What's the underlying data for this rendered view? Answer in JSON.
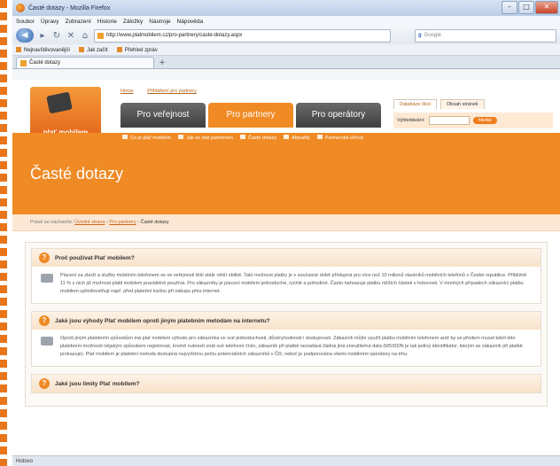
{
  "window": {
    "title": "Časté dotazy - Mozilla Firefox"
  },
  "menu": [
    "Soubor",
    "Úpravy",
    "Zobrazení",
    "Historie",
    "Záložky",
    "Nástroje",
    "Nápověda"
  ],
  "nav": {
    "url": "http://www.platmobilem.cz/pro-partnery/caste-dotazy.aspx",
    "search_placeholder": "Google"
  },
  "bookmarks": [
    "Nejnavštěvovanější",
    "Jak začít",
    "Přehled zpráv"
  ],
  "tab": {
    "label": "Časté dotazy"
  },
  "site": {
    "logo_text": "plať mobilem",
    "top_links": [
      "Home",
      "Přihlášení pro partnery"
    ],
    "main_tabs": [
      "Pro veřejnost",
      "Pro partnery",
      "Pro operátory"
    ],
    "right_tabs": [
      "Databáze škol",
      "Obsah stránek"
    ],
    "search_label": "Vyhledávání:",
    "search_button": "hledat",
    "sub_nav": [
      "Co je plať mobilem",
      "Jak se stát partnerem",
      "Časté dotazy",
      "Aktuality",
      "Partnerská síťová"
    ],
    "page_title": "Časté dotazy",
    "breadcrumb": {
      "prefix": "Právě se nacházíte:",
      "home": "Úvodní strana",
      "sep1": "›",
      "section": "Pro partnery",
      "sep2": "›",
      "current": "Časté dotazy"
    }
  },
  "faqs": [
    {
      "q": "Proč používat Plať mobilem?",
      "a": "Placení za zboží a služby mobilním telefonem se ve veřejnosti těší stále větší oblibě. Tato možnost platby je v současné době přístupná pro více než 10 milionů vlastníků mobilních telefonů v České republice. Přibližně 11 % z nich již možnost platit mobilem pravidelně používá. Pro zákazníky je placení mobilem jednoduché, rychlé a pohodlné. Často nahrazuje platbu nižších částek v hotovosti. V mnohých případech zákazníci platbu mobilem upřednostňují např. před platební kartou při nákupu přes internet."
    },
    {
      "q": "Jaké jsou výhody Plať mobilem oproti jiným platebním metodám na internetu?",
      "a": "Oproti jiným platebním způsobům má plať mobilem výhodu pro zákazníka ve své jednoduchosti, důvěryhodnosti i dostupnosti. Zákazník může využít platbu mobilním telefonem aniž by se předem musel kdoli této platebním možnosti nějakým způsobem registrovat, kromě nutnosti znát své telefonní číslo, zákazník při platbě nezadává žádná jiná zneužitelná data (MSISDN je tak jediný identifikátor, kterým se zákazník při platbě prokazuje). Plať mobilem je platební metoda dostupná nejvyššímu počtu potenciálních zákazníků v ČR, neboť je podporována všemi mobilními operátory na trhu."
    },
    {
      "q": "Jaké jsou limity Plať mobilem?",
      "a": ""
    }
  ],
  "status": "Hotovo"
}
